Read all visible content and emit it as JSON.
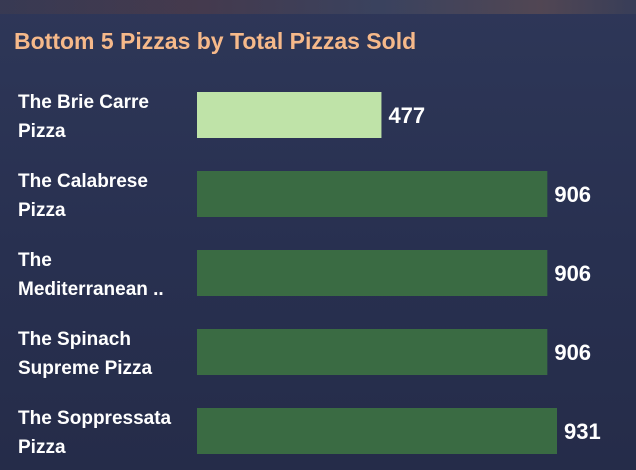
{
  "chart_data": {
    "type": "bar",
    "orientation": "horizontal",
    "title": "Bottom 5 Pizzas by Total Pizzas Sold",
    "categories": [
      [
        "The Brie Carre",
        "Pizza"
      ],
      [
        "The Calabrese",
        "Pizza"
      ],
      [
        "The",
        "Mediterranean .."
      ],
      [
        "The Spinach",
        "Supreme Pizza"
      ],
      [
        "The Soppressata",
        "Pizza"
      ]
    ],
    "values": [
      477,
      906,
      906,
      906,
      931
    ],
    "value_labels": [
      "477",
      "906",
      "906",
      "906",
      "931"
    ],
    "highlight_color": "#bfe3a8",
    "bar_color": "#3a6b43",
    "title_color": "#f6b98a",
    "xlim": [
      0,
      931
    ],
    "grid": false,
    "legend": "none"
  }
}
